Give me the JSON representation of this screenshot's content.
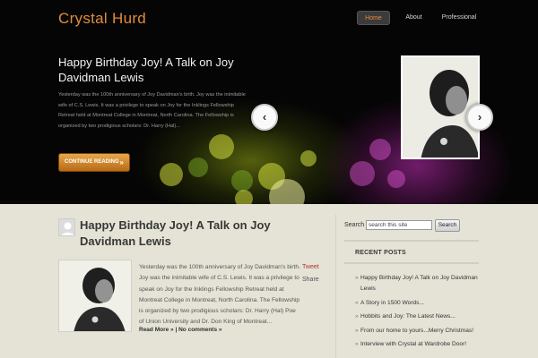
{
  "site": {
    "title": "Crystal Hurd"
  },
  "nav": {
    "items": [
      "Home",
      "About",
      "Professional"
    ]
  },
  "featured": {
    "title": "Happy Birthday Joy! A Talk on Joy Davidman Lewis",
    "excerpt": "Yesterday was the 100th anniversary of Joy Davidman's birth. Joy was the inimitable wife of C.S. Lewis. It was a privilege to speak on Joy for the Inklings Fellowship Retreat held at Montreat College in Montreat, North Carolina. The Fellowship is organized by two prodigious scholars: Dr. Harry (Hal)...",
    "button_label": "CONTINUE READING",
    "button_arrow": "»",
    "prev_arrow": "‹",
    "next_arrow": "›"
  },
  "post": {
    "title": "Happy Birthday Joy! A Talk on Joy Davidman Lewis",
    "excerpt": "Yesterday was the 100th anniversary of Joy Davidman's birth. Joy was the inimitable wife of C.S. Lewis. It was a privilege to speak on Joy for the Inklings Fellowship Retreat held at Montreat College in Montreat, North Carolina. The Fellowship is organized by two prodigious scholars: Dr. Harry (Hal) Poe of Union University and Dr. Don King of Montreat...",
    "tweet_label": "Tweet",
    "share_label": "Share",
    "read_more": "Read More »",
    "separator": "|",
    "comments": "No comments »"
  },
  "sidebar": {
    "search_label": "Search",
    "search_value": "search this site",
    "search_button": "Search",
    "recent_heading": "RECENT POSTS",
    "recent_posts": [
      "Happy Birthday Joy! A Talk on Joy Davidman Lewis",
      "A Story in 1500 Words...",
      "Hobbits and Joy: The Latest News...",
      "From our home to yours...Merry Christmas!",
      "Interview with Crystal at Wardrobe Door!"
    ]
  },
  "colors": {
    "accent": "#e08c3e",
    "link_red": "#b43232",
    "background": "#e4e3d6"
  }
}
